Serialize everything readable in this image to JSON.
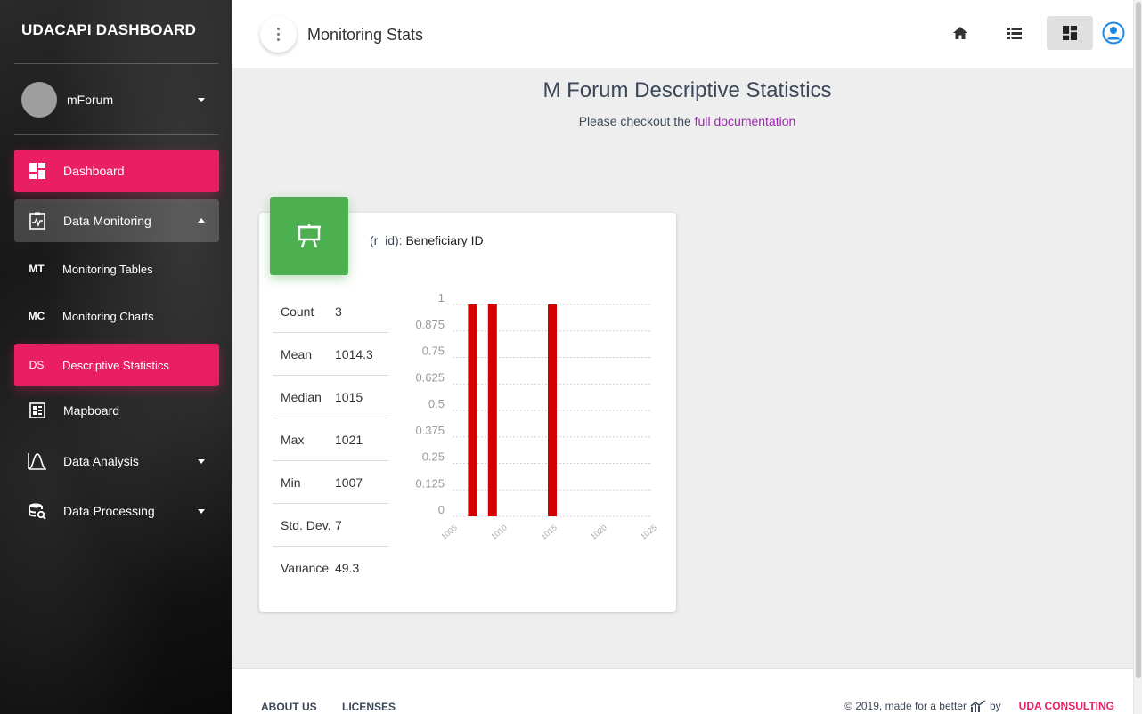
{
  "sidebar": {
    "brand": "UDACAPI DASHBOARD",
    "user": "mForum",
    "items": [
      {
        "label": "Dashboard"
      },
      {
        "label": "Data Monitoring"
      },
      {
        "abbr": "MT",
        "label": "Monitoring Tables"
      },
      {
        "abbr": "MC",
        "label": "Monitoring Charts"
      },
      {
        "abbr": "DS",
        "label": "Descriptive Statistics"
      },
      {
        "label": "Mapboard"
      },
      {
        "label": "Data Analysis"
      },
      {
        "label": "Data Processing"
      }
    ]
  },
  "topbar": {
    "heading": "Monitoring Stats",
    "icons": [
      "home-icon",
      "list-icon",
      "dashboard-icon",
      "account-circle-icon"
    ]
  },
  "main": {
    "title": "M Forum Descriptive Statistics",
    "subtitle_prefix": "Please checkout the",
    "subtitle_link": "full documentation"
  },
  "card": {
    "icon": "presentation-board-icon",
    "title_prefix": "(r_id):",
    "title_label": "Beneficiary ID",
    "stats": [
      {
        "label": "Count",
        "value": "3"
      },
      {
        "label": "Mean",
        "value": "1014.3"
      },
      {
        "label": "Median",
        "value": "1015"
      },
      {
        "label": "Max",
        "value": "1021"
      },
      {
        "label": "Min",
        "value": "1007"
      },
      {
        "label": "Std. Dev.",
        "value": "7"
      },
      {
        "label": "Variance",
        "value": "49.3"
      }
    ]
  },
  "chart_data": {
    "type": "bar",
    "x_values": [
      1007,
      1009,
      1015
    ],
    "values": [
      1,
      1,
      1
    ],
    "x_ticks": [
      "1005",
      "1010",
      "1015",
      "1020",
      "1025"
    ],
    "y_ticks": [
      "1",
      "0.875",
      "0.75",
      "0.625",
      "0.5",
      "0.375",
      "0.25",
      "0.125",
      "0"
    ],
    "ylim": [
      0,
      1
    ],
    "xlim": [
      1005,
      1025
    ],
    "grid": true,
    "bar_color": "#d50000"
  },
  "footer": {
    "about": "ABOUT US",
    "licenses": "LICENSES",
    "copyright": "© 2019, made for a better",
    "by": "by",
    "company": "UDA CONSULTING"
  },
  "colors": {
    "accent": "#e91e63",
    "success": "#4caf50",
    "link": "#9c27b0"
  }
}
